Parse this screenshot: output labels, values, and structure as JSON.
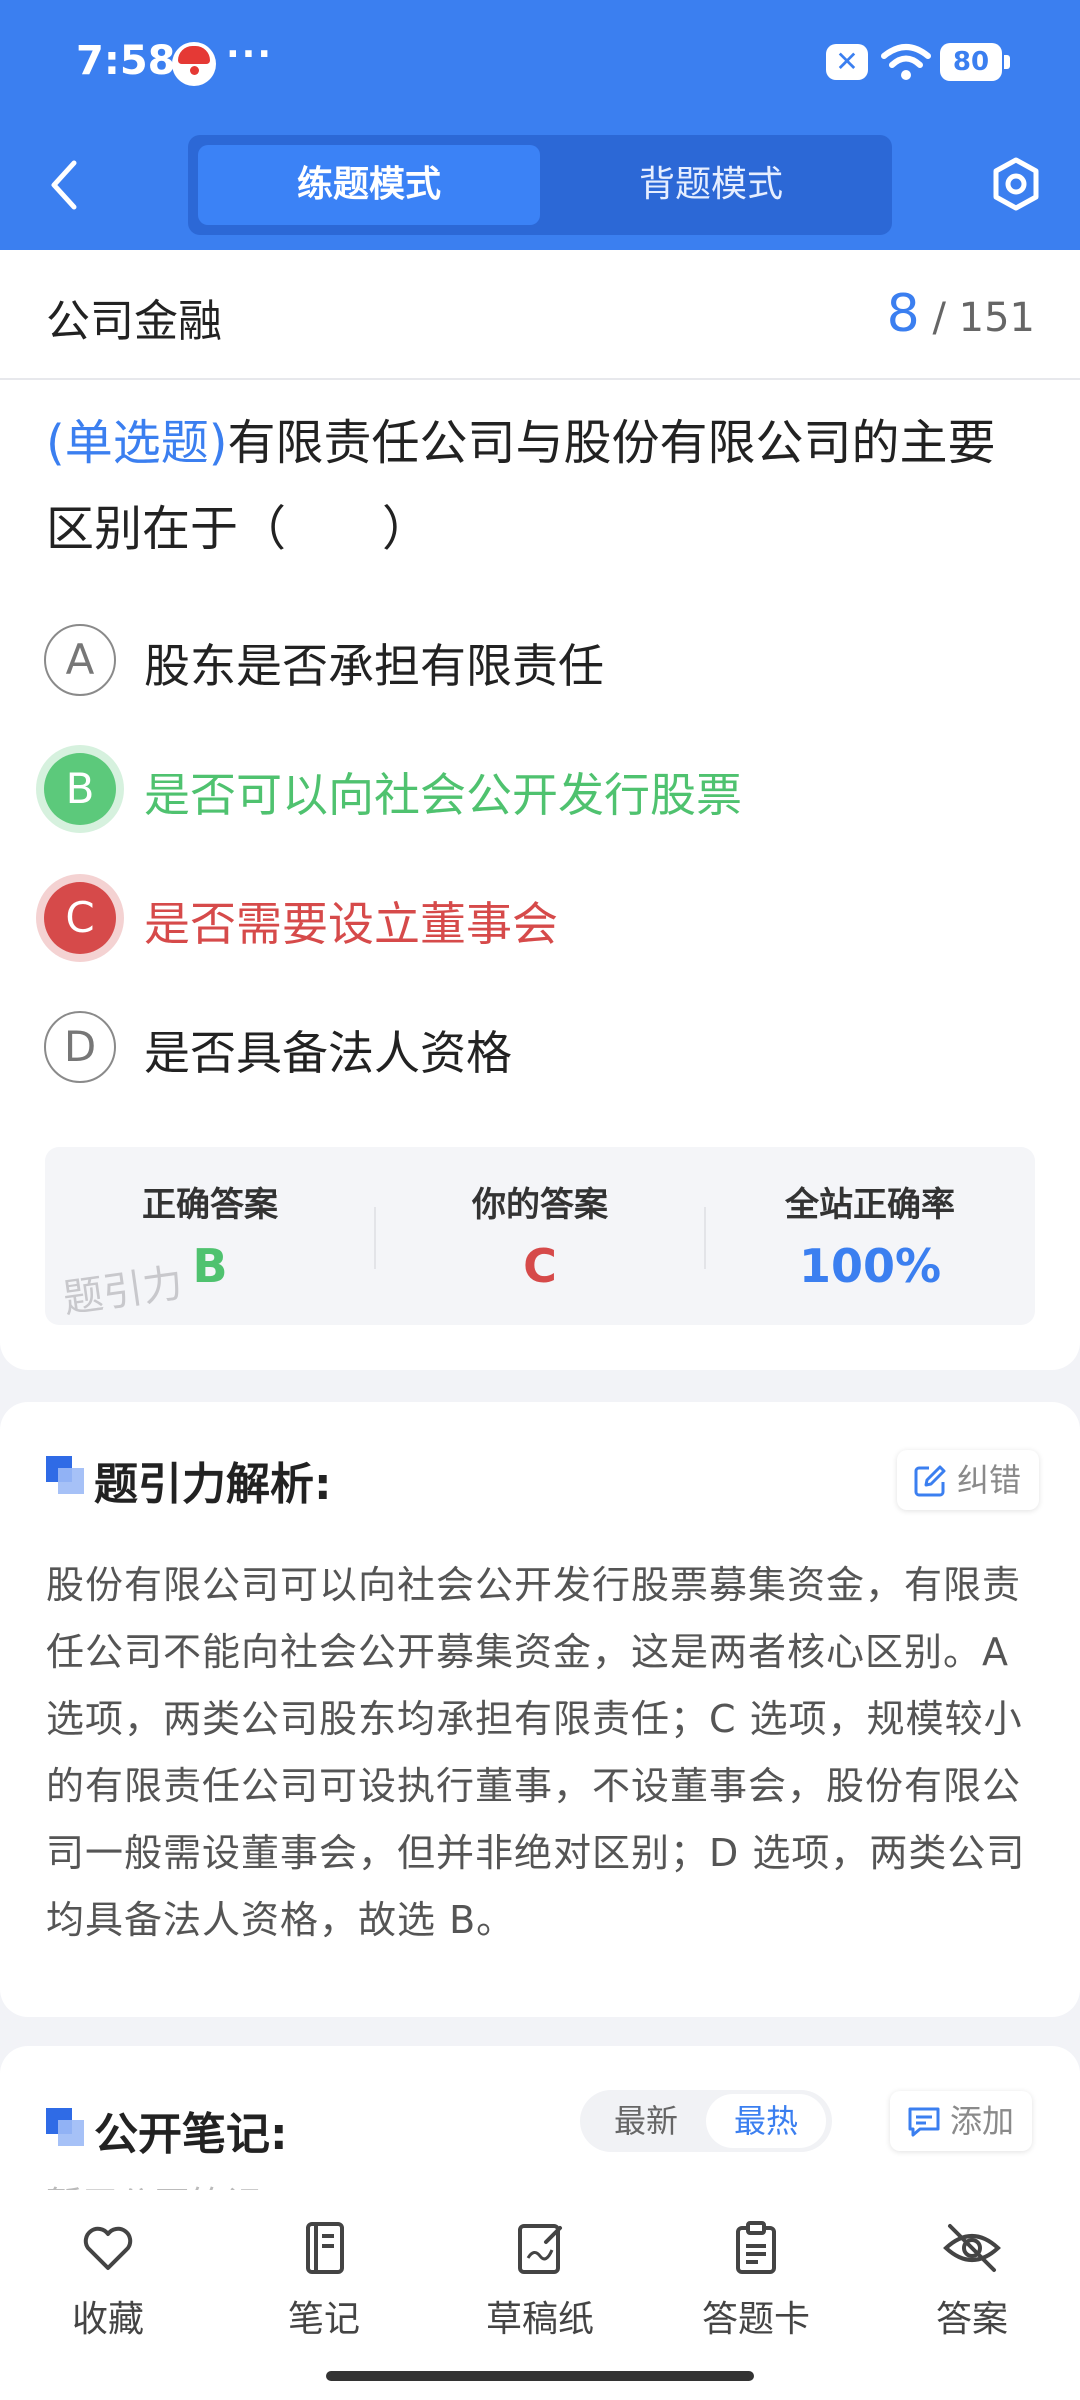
{
  "status_bar": {
    "time": "7:58",
    "dots": "···",
    "battery": "80"
  },
  "header": {
    "tabs": [
      {
        "label": "练题模式",
        "active": true
      },
      {
        "label": "背题模式",
        "active": false
      }
    ]
  },
  "subject": {
    "title": "公司金融",
    "current": "8",
    "total": "/ 151"
  },
  "question": {
    "type_label": "(单选题)",
    "text": "有限责任公司与股份有限公司的主要区别在于（　　）",
    "options": [
      {
        "letter": "A",
        "text": "股东是否承担有限责任",
        "state": "normal"
      },
      {
        "letter": "B",
        "text": "是否可以向社会公开发行股票",
        "state": "correct"
      },
      {
        "letter": "C",
        "text": "是否需要设立董事会",
        "state": "wrong"
      },
      {
        "letter": "D",
        "text": "是否具备法人资格",
        "state": "normal"
      }
    ]
  },
  "answer_summary": {
    "correct_label": "正确答案",
    "correct_value": "B",
    "yours_label": "你的答案",
    "yours_value": "C",
    "rate_label": "全站正确率",
    "rate_value": "100%",
    "watermark": "题引力"
  },
  "analysis": {
    "title": "题引力解析:",
    "report_button": "纠错",
    "text": "股份有限公司可以向社会公开发行股票募集资金，有限责任公司不能向社会公开募集资金，这是两者核心区别。A 选项，两类公司股东均承担有限责任；C 选项，规模较小的有限责任公司可设执行董事，不设董事会，股份有限公司一般需设董事会，但并非绝对区别；D 选项，两类公司均具备法人资格，故选 B。"
  },
  "notes": {
    "title": "公开笔记:",
    "sort_new": "最新",
    "sort_hot": "最热",
    "add_button": "添加",
    "peek_text": "暂无公开笔记"
  },
  "bottom_nav": [
    {
      "label": "收藏",
      "icon": "heart-icon"
    },
    {
      "label": "笔记",
      "icon": "notebook-icon"
    },
    {
      "label": "草稿纸",
      "icon": "draft-icon"
    },
    {
      "label": "答题卡",
      "icon": "clipboard-icon"
    },
    {
      "label": "答案",
      "icon": "eye-off-icon"
    }
  ],
  "colors": {
    "primary": "#3b7ff0",
    "correct": "#4fc26f",
    "wrong": "#d64a4a"
  }
}
